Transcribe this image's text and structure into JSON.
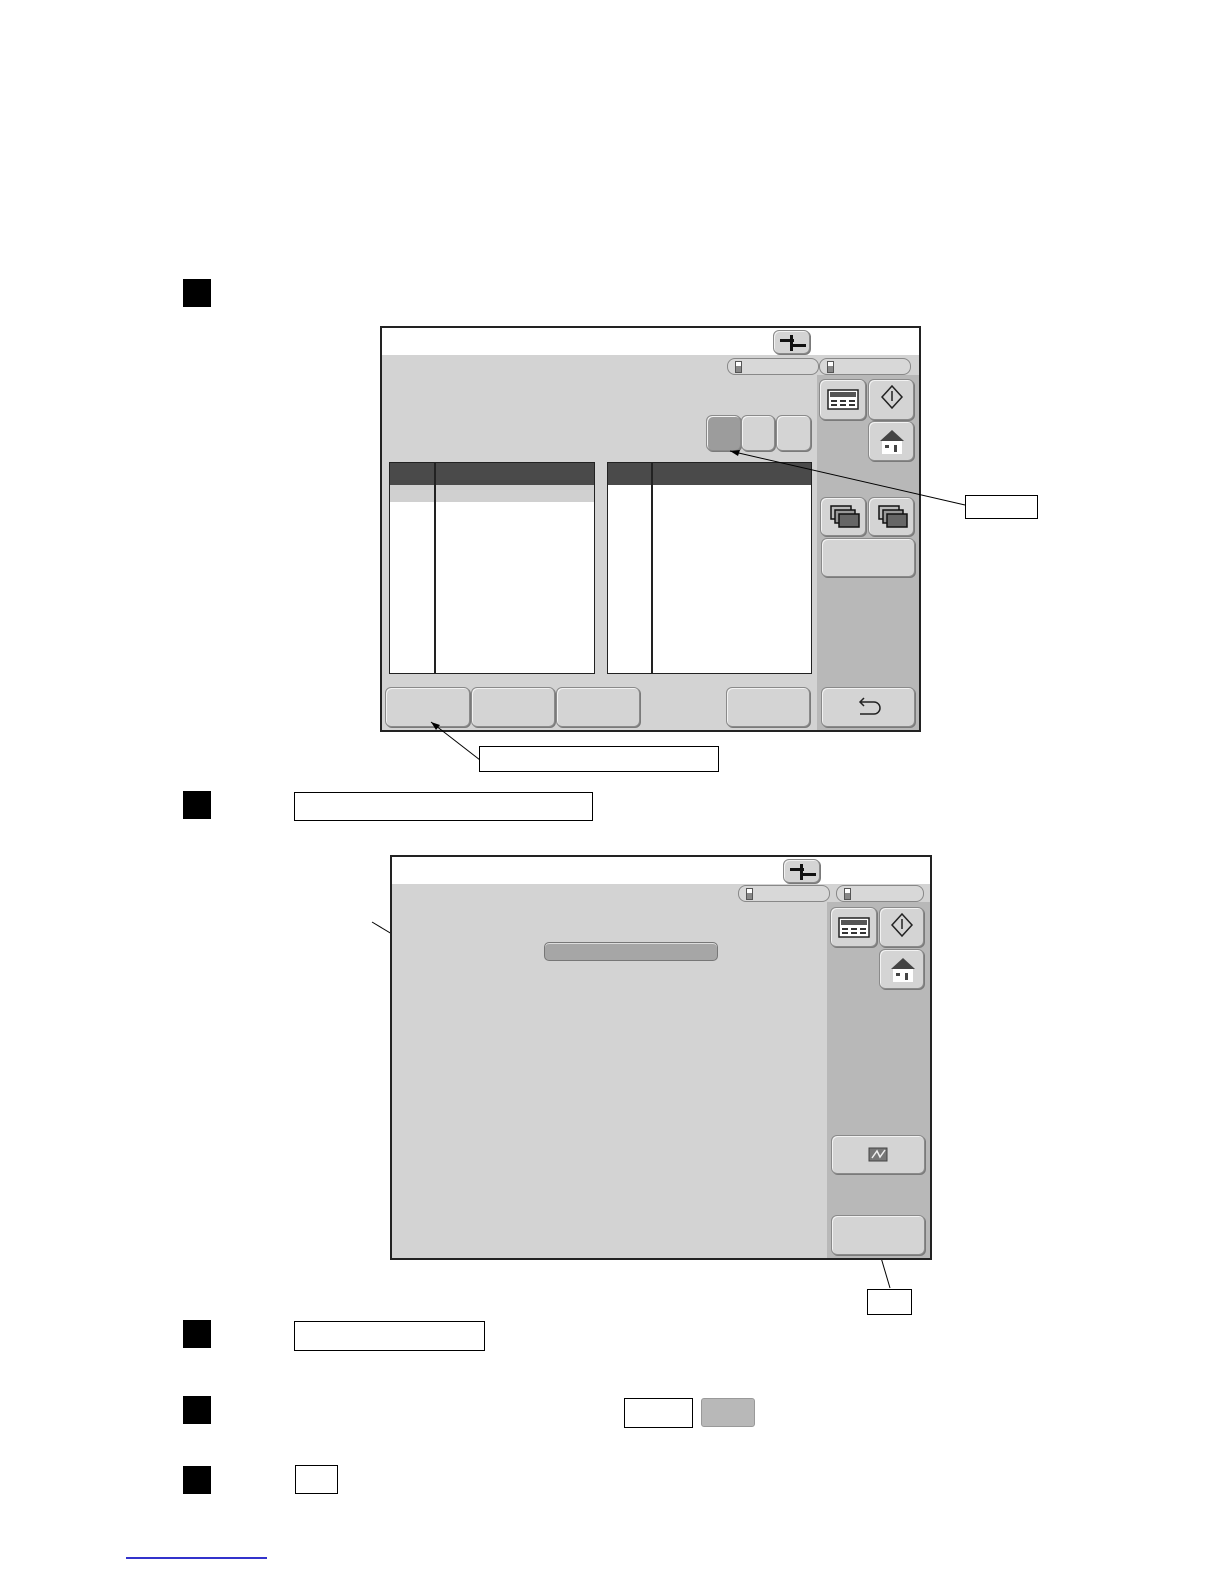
{
  "colors": {
    "screen_bg": "#d3d3d3",
    "sidebar_bg": "#b8b8b8",
    "header_bar": "#4a4a4a",
    "selected_key": "#9c9c9c",
    "highlight_row": "#d0d0d0",
    "step_marker": "#000000"
  },
  "icons": [
    "tool-icon",
    "gauge-icon",
    "menu-panel-icon",
    "start-diamond-icon",
    "home-icon",
    "copy-stack-icon",
    "wave-icon",
    "return-arrow-icon"
  ]
}
